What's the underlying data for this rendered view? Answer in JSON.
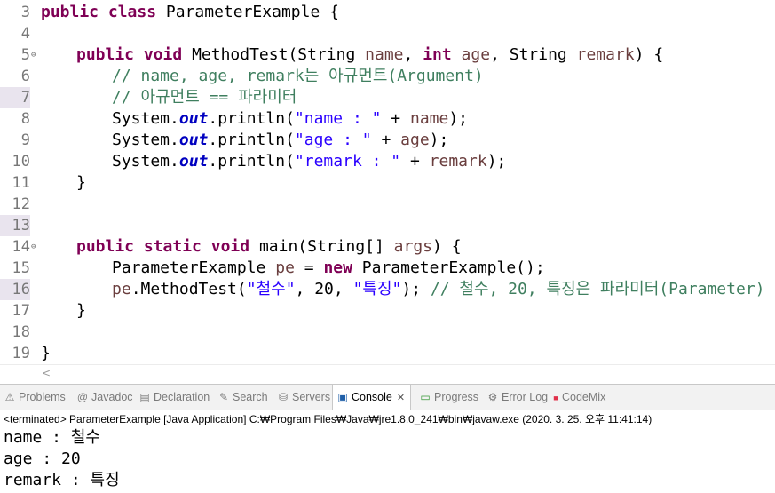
{
  "editor": {
    "line_numbers": [
      "3",
      "4",
      "5",
      "6",
      "7",
      "8",
      "9",
      "10",
      "11",
      "12",
      "13",
      "14",
      "15",
      "16",
      "17",
      "18",
      "19"
    ],
    "lines": {
      "l3": {
        "kw_public": "public",
        "kw_class": "class",
        "rest": " ParameterExample {"
      },
      "l5": {
        "kw_public": "public",
        "kw_void": "void",
        "name": " MethodTest(String ",
        "p_name": "name",
        "sep1": ", ",
        "kw_int": "int",
        "p_age": "age",
        "sep2": ", String ",
        "p_remark": "remark",
        "end": ") {"
      },
      "l6": {
        "comment": "// name, age, remark는 아규먼트(Argument)"
      },
      "l7": {
        "comment": "// 아규먼트 == 파라미터"
      },
      "l8": {
        "sys": "System.",
        "out": "out",
        "call": ".println(",
        "str": "\"name : \"",
        "plus": " + ",
        "var": "name",
        "end": ");"
      },
      "l9": {
        "sys": "System.",
        "out": "out",
        "call": ".println(",
        "str": "\"age : \"",
        "plus": " + ",
        "var": "age",
        "end": ");"
      },
      "l10": {
        "sys": "System.",
        "out": "out",
        "call": ".println(",
        "str": "\"remark : \"",
        "plus": " + ",
        "var": "remark",
        "end": ");"
      },
      "l11": {
        "text": "}"
      },
      "l14": {
        "kw_public": "public",
        "kw_static": "static",
        "kw_void": "void",
        "rest": " main(String[] ",
        "p_args": "args",
        "end": ") {"
      },
      "l15": {
        "type": "ParameterExample ",
        "var": "pe",
        "eq": " = ",
        "kw_new": "new",
        "rest": " ParameterExample();"
      },
      "l16": {
        "var": "pe",
        "call": ".MethodTest(",
        "s1": "\"철수\"",
        "mid": ", 20, ",
        "s2": "\"특징\"",
        "end": "); ",
        "comment": "// 철수, 20, 특징은 파라미터(Parameter)"
      },
      "l17": {
        "text": "}"
      },
      "l19": {
        "text": "}"
      }
    },
    "scroll_arrow": "<"
  },
  "views": {
    "tabs": [
      {
        "label": "Problems",
        "icon": "problems-icon",
        "glyph": "⚠"
      },
      {
        "label": "Javadoc",
        "icon": "javadoc-icon",
        "glyph": "@"
      },
      {
        "label": "Declaration",
        "icon": "declaration-icon",
        "glyph": "▤"
      },
      {
        "label": "Search",
        "icon": "search-icon",
        "glyph": "✎"
      },
      {
        "label": "Servers",
        "icon": "servers-icon",
        "glyph": "⛁"
      },
      {
        "label": "Console",
        "icon": "console-icon",
        "glyph": "▣",
        "close": "✕"
      },
      {
        "label": "Progress",
        "icon": "progress-icon",
        "glyph": "▭"
      },
      {
        "label": "Error Log",
        "icon": "error-log-icon",
        "glyph": "⚙"
      },
      {
        "label": "CodeMix",
        "icon": "codemix-icon",
        "glyph": "■"
      }
    ],
    "console": {
      "status": "<terminated> ParameterExample [Java Application] C:₩Program Files₩Java₩jre1.8.0_241₩bin₩javaw.exe (2020. 3. 25. 오후 11:41:14)",
      "output": [
        "name : 철수",
        "age : 20",
        "remark : 특징"
      ]
    }
  },
  "colors": {
    "keyword": "#7f0055",
    "comment": "#3f7f5f",
    "string": "#2a00ff",
    "field": "#0000c0"
  }
}
